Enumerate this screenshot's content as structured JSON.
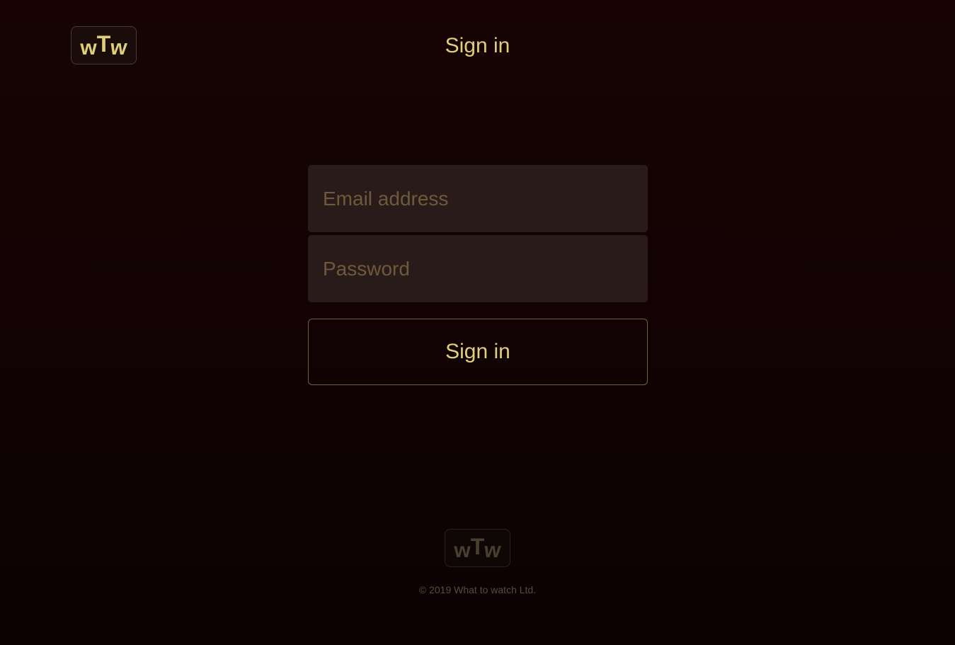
{
  "header": {
    "logo": {
      "letters": [
        "w",
        "T",
        "w"
      ],
      "color": "#dfcf77"
    },
    "title": "Sign in"
  },
  "form": {
    "email": {
      "value": "",
      "placeholder": "Email address"
    },
    "password": {
      "value": "",
      "placeholder": "Password"
    },
    "submit_label": "Sign in"
  },
  "footer": {
    "logo": {
      "letters": [
        "w",
        "T",
        "w"
      ],
      "color": "#4a3f2e"
    },
    "copyright": "© 2019 What to watch Ltd."
  },
  "colors": {
    "background": "#170303",
    "accent": "#dfcf77",
    "field_background": "#2a1b1b",
    "placeholder": "#6e593a"
  }
}
